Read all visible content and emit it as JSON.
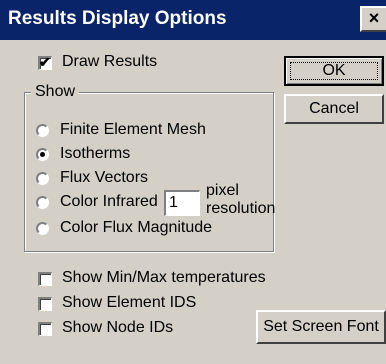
{
  "window": {
    "title": "Results Display Options",
    "close_glyph": "×"
  },
  "draw_results": {
    "label": "Draw Results",
    "checked": true
  },
  "show_group": {
    "label": "Show",
    "options": [
      {
        "label": "Finite Element Mesh",
        "selected": false
      },
      {
        "label": "Isotherms",
        "selected": true
      },
      {
        "label": "Flux Vectors",
        "selected": false
      },
      {
        "label": "Color Infrared",
        "selected": false
      },
      {
        "label": "Color Flux Magnitude",
        "selected": false
      }
    ],
    "pixel_resolution": {
      "value": "1",
      "label_line1": "pixel",
      "label_line2": "resolution"
    }
  },
  "checks": [
    {
      "label": "Show Min/Max temperatures",
      "checked": false
    },
    {
      "label": "Show Element IDS",
      "checked": false
    },
    {
      "label": "Show Node IDs",
      "checked": false
    }
  ],
  "buttons": {
    "ok": "OK",
    "cancel": "Cancel",
    "set_font": "Set Screen Font"
  },
  "check_glyph": "✔"
}
